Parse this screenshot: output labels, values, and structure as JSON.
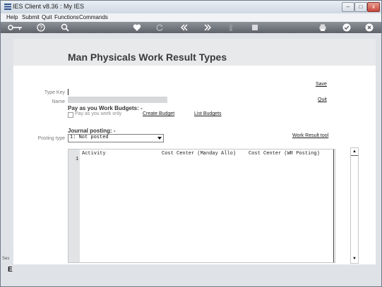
{
  "window": {
    "title": "IES Client v8.36 : My IES",
    "minimize": "–",
    "maximize": "□",
    "close": "x"
  },
  "menu": {
    "items": [
      "Help",
      "Submit",
      "Quit",
      "Functions",
      "Commands"
    ]
  },
  "toolbar": {
    "icons": [
      "key-icon",
      "help-icon",
      "search-icon",
      "heart-icon",
      "refresh-icon",
      "rewind-icon",
      "fast-forward-icon",
      "upload-icon",
      "stop-icon",
      "print-icon",
      "check-icon",
      "close-icon"
    ]
  },
  "page": {
    "title": "Man Physicals Work Result Types"
  },
  "form": {
    "type_key_label": "Type Key",
    "type_key_value": "",
    "name_label": "Name",
    "name_value": "",
    "save_link": "Save",
    "quit_link": "Quit",
    "payg_heading": "Pay as you Work Budgets: -",
    "payg_only_label": "Pay as you work only",
    "payg_only_checked": false,
    "create_budget_link": "Create Budget",
    "list_budgets_link": "List Budgets",
    "journal_heading": "Journal posting: -",
    "posting_type_label": "Posting type",
    "posting_type_value": "1: Not posted",
    "work_result_tool_link": "Work Result tool"
  },
  "grid": {
    "columns": [
      "Activity",
      "Cost Center (Manday Allo)",
      "Cost Center (WR Posting)"
    ],
    "row_numbers": [
      "1"
    ]
  },
  "side": {
    "label1": "Ses",
    "label2": "E"
  },
  "colors": {
    "toolbar": "#6f747b",
    "band": "#e8e9eb"
  }
}
